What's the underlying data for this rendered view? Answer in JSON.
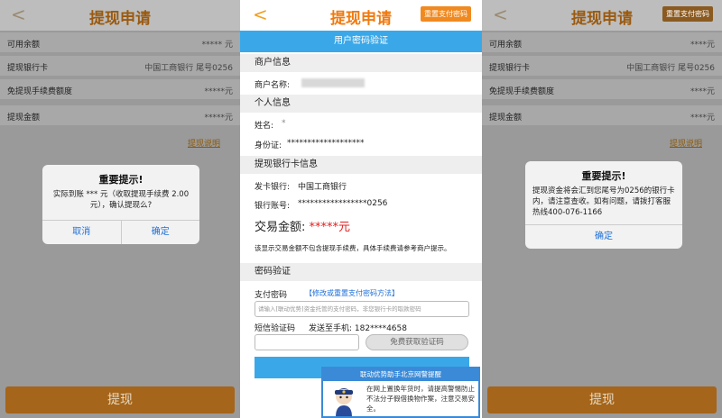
{
  "common": {
    "back": "<",
    "title": "提现申请",
    "reset_pay_pwd": "重置支付密码"
  },
  "left": {
    "rows": [
      {
        "label": "可用余额",
        "value": "***** 元"
      },
      {
        "label": "提现银行卡",
        "value": "中国工商银行  尾号0256"
      },
      {
        "label": "免提现手续费额度",
        "value": "*****元"
      },
      {
        "label": "提现金额",
        "value": "*****元"
      }
    ],
    "withdraw_note_link": "提现说明",
    "dialog": {
      "title": "重要提示!",
      "message": "实际到账 *** 元（收取提现手续费 2.00元），确认提现么?",
      "cancel": "取消",
      "confirm": "确定"
    },
    "submit": "提现"
  },
  "middle": {
    "header_bar": "用户密码验证",
    "merchant_section": "商户信息",
    "merchant_name_label": "商户名称:",
    "personal_section": "个人信息",
    "name_label": "姓名:",
    "name_value": "*",
    "id_label": "身份证:",
    "id_value": "*******************",
    "bank_section": "提现银行卡信息",
    "issuing_bank_label": "发卡银行:",
    "issuing_bank_value": "中国工商银行",
    "account_label": "银行账号:",
    "account_value": "*****************0256",
    "amount_label": "交易金额:",
    "amount_value": "*****元",
    "notice": "该显示交易金额不包含提现手续费，具体手续费请参考商户提示。",
    "password_section": "密码验证",
    "pay_pwd_label": "支付密码",
    "pay_pwd_link": "【修改或重置支付密码方法】",
    "pay_pwd_placeholder": "请输入[联动优势]资金托管的支付密码，非您银行卡的取款密码",
    "sms_label": "短信验证码",
    "sent_to": "发送至手机:  182****4658",
    "get_code": "免费获取验证码",
    "popup_title": "联动优势助手北京网警提醒",
    "popup_text": "在网上置换年货时，请提高警惕防止不法分子假借换物作案，注意交易安全。"
  },
  "right": {
    "rows": [
      {
        "label": "可用余额",
        "value": "****元"
      },
      {
        "label": "提现银行卡",
        "value": "中国工商银行  尾号0256"
      },
      {
        "label": "免提现手续费额度",
        "value": "****元"
      },
      {
        "label": "提现金额",
        "value": "****元"
      }
    ],
    "withdraw_note_link": "提现说明",
    "dialog": {
      "title": "重要提示!",
      "message": "提现资金将会汇到您尾号为0256的银行卡内，请注意查收。如有问题，请拨打客服热线400-076-1166",
      "confirm": "确定"
    },
    "submit": "提现"
  }
}
